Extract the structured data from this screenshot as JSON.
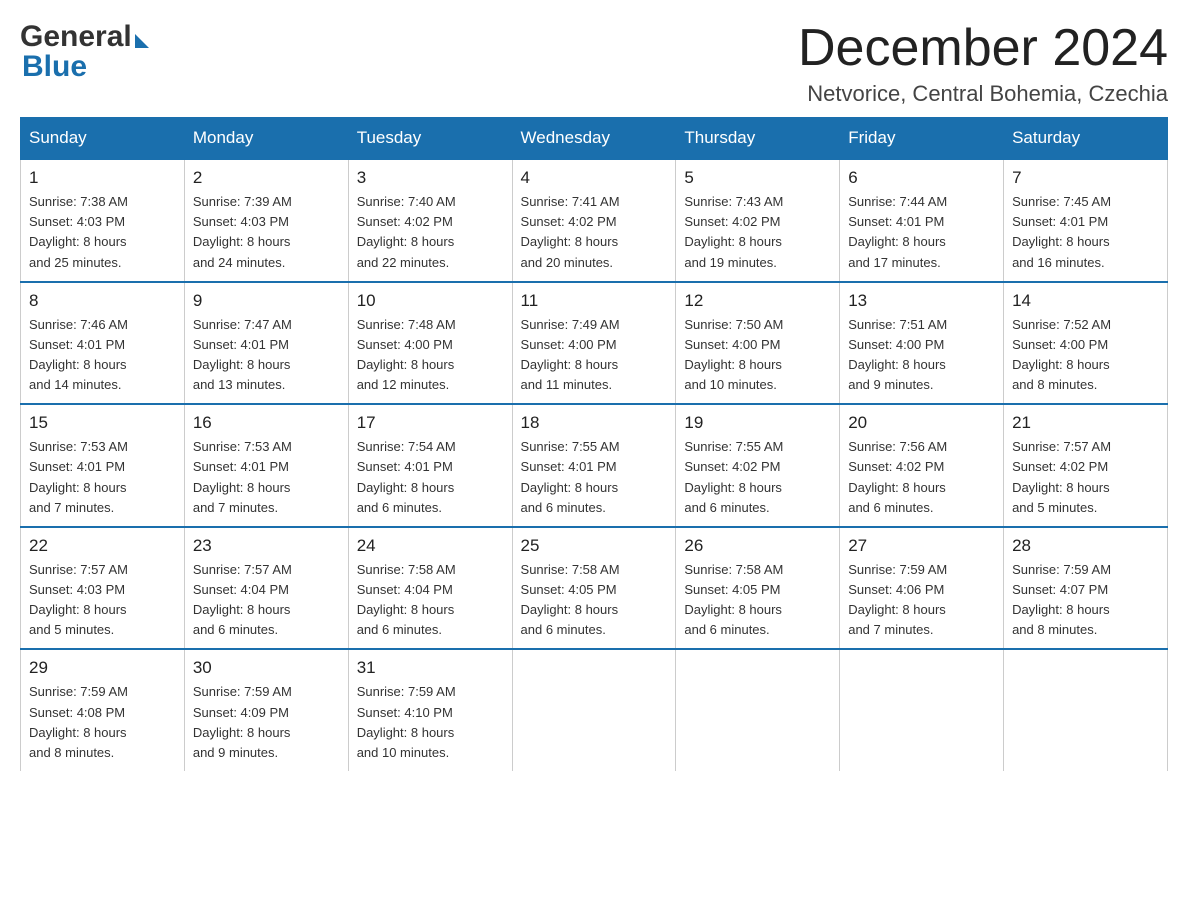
{
  "header": {
    "logo_general": "General",
    "logo_blue": "Blue",
    "month_title": "December 2024",
    "subtitle": "Netvorice, Central Bohemia, Czechia"
  },
  "days_of_week": [
    "Sunday",
    "Monday",
    "Tuesday",
    "Wednesday",
    "Thursday",
    "Friday",
    "Saturday"
  ],
  "weeks": [
    [
      {
        "day": "1",
        "sunrise": "7:38 AM",
        "sunset": "4:03 PM",
        "daylight": "8 hours and 25 minutes."
      },
      {
        "day": "2",
        "sunrise": "7:39 AM",
        "sunset": "4:03 PM",
        "daylight": "8 hours and 24 minutes."
      },
      {
        "day": "3",
        "sunrise": "7:40 AM",
        "sunset": "4:02 PM",
        "daylight": "8 hours and 22 minutes."
      },
      {
        "day": "4",
        "sunrise": "7:41 AM",
        "sunset": "4:02 PM",
        "daylight": "8 hours and 20 minutes."
      },
      {
        "day": "5",
        "sunrise": "7:43 AM",
        "sunset": "4:02 PM",
        "daylight": "8 hours and 19 minutes."
      },
      {
        "day": "6",
        "sunrise": "7:44 AM",
        "sunset": "4:01 PM",
        "daylight": "8 hours and 17 minutes."
      },
      {
        "day": "7",
        "sunrise": "7:45 AM",
        "sunset": "4:01 PM",
        "daylight": "8 hours and 16 minutes."
      }
    ],
    [
      {
        "day": "8",
        "sunrise": "7:46 AM",
        "sunset": "4:01 PM",
        "daylight": "8 hours and 14 minutes."
      },
      {
        "day": "9",
        "sunrise": "7:47 AM",
        "sunset": "4:01 PM",
        "daylight": "8 hours and 13 minutes."
      },
      {
        "day": "10",
        "sunrise": "7:48 AM",
        "sunset": "4:00 PM",
        "daylight": "8 hours and 12 minutes."
      },
      {
        "day": "11",
        "sunrise": "7:49 AM",
        "sunset": "4:00 PM",
        "daylight": "8 hours and 11 minutes."
      },
      {
        "day": "12",
        "sunrise": "7:50 AM",
        "sunset": "4:00 PM",
        "daylight": "8 hours and 10 minutes."
      },
      {
        "day": "13",
        "sunrise": "7:51 AM",
        "sunset": "4:00 PM",
        "daylight": "8 hours and 9 minutes."
      },
      {
        "day": "14",
        "sunrise": "7:52 AM",
        "sunset": "4:00 PM",
        "daylight": "8 hours and 8 minutes."
      }
    ],
    [
      {
        "day": "15",
        "sunrise": "7:53 AM",
        "sunset": "4:01 PM",
        "daylight": "8 hours and 7 minutes."
      },
      {
        "day": "16",
        "sunrise": "7:53 AM",
        "sunset": "4:01 PM",
        "daylight": "8 hours and 7 minutes."
      },
      {
        "day": "17",
        "sunrise": "7:54 AM",
        "sunset": "4:01 PM",
        "daylight": "8 hours and 6 minutes."
      },
      {
        "day": "18",
        "sunrise": "7:55 AM",
        "sunset": "4:01 PM",
        "daylight": "8 hours and 6 minutes."
      },
      {
        "day": "19",
        "sunrise": "7:55 AM",
        "sunset": "4:02 PM",
        "daylight": "8 hours and 6 minutes."
      },
      {
        "day": "20",
        "sunrise": "7:56 AM",
        "sunset": "4:02 PM",
        "daylight": "8 hours and 6 minutes."
      },
      {
        "day": "21",
        "sunrise": "7:57 AM",
        "sunset": "4:02 PM",
        "daylight": "8 hours and 5 minutes."
      }
    ],
    [
      {
        "day": "22",
        "sunrise": "7:57 AM",
        "sunset": "4:03 PM",
        "daylight": "8 hours and 5 minutes."
      },
      {
        "day": "23",
        "sunrise": "7:57 AM",
        "sunset": "4:04 PM",
        "daylight": "8 hours and 6 minutes."
      },
      {
        "day": "24",
        "sunrise": "7:58 AM",
        "sunset": "4:04 PM",
        "daylight": "8 hours and 6 minutes."
      },
      {
        "day": "25",
        "sunrise": "7:58 AM",
        "sunset": "4:05 PM",
        "daylight": "8 hours and 6 minutes."
      },
      {
        "day": "26",
        "sunrise": "7:58 AM",
        "sunset": "4:05 PM",
        "daylight": "8 hours and 6 minutes."
      },
      {
        "day": "27",
        "sunrise": "7:59 AM",
        "sunset": "4:06 PM",
        "daylight": "8 hours and 7 minutes."
      },
      {
        "day": "28",
        "sunrise": "7:59 AM",
        "sunset": "4:07 PM",
        "daylight": "8 hours and 8 minutes."
      }
    ],
    [
      {
        "day": "29",
        "sunrise": "7:59 AM",
        "sunset": "4:08 PM",
        "daylight": "8 hours and 8 minutes."
      },
      {
        "day": "30",
        "sunrise": "7:59 AM",
        "sunset": "4:09 PM",
        "daylight": "8 hours and 9 minutes."
      },
      {
        "day": "31",
        "sunrise": "7:59 AM",
        "sunset": "4:10 PM",
        "daylight": "8 hours and 10 minutes."
      },
      null,
      null,
      null,
      null
    ]
  ],
  "labels": {
    "sunrise": "Sunrise: ",
    "sunset": "Sunset: ",
    "daylight": "Daylight: "
  }
}
